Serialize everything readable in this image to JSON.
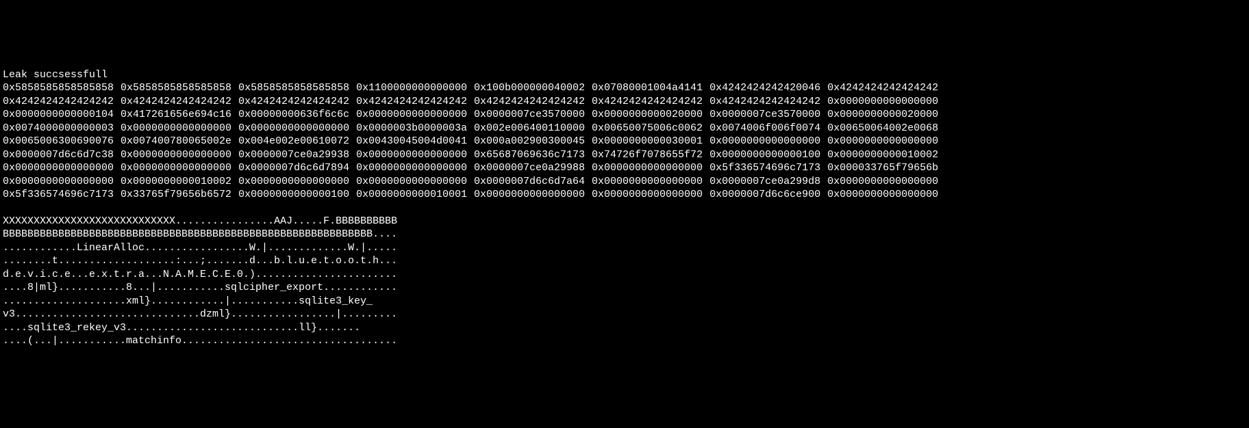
{
  "header": "Leak succsessfull",
  "hex_rows": [
    [
      "0x5858585858585858",
      "0x5858585858585858",
      "0x5858585858585858",
      "0x1100000000000000",
      "0x100b000000040002",
      "0x07080001004a4141",
      "0x4242424242420046",
      "0x4242424242424242"
    ],
    [
      "0x4242424242424242",
      "0x4242424242424242",
      "0x4242424242424242",
      "0x4242424242424242",
      "0x4242424242424242",
      "0x4242424242424242",
      "0x4242424242424242",
      "0x0000000000000000"
    ],
    [
      "0x0000000000000104",
      "0x417261656e694c16",
      "0x00000000636f6c6c",
      "0x0000000000000000",
      "0x0000007ce3570000",
      "0x0000000000020000",
      "0x0000007ce3570000",
      "0x0000000000020000"
    ],
    [
      "0x0074000000000003",
      "0x0000000000000000",
      "0x0000000000000000",
      "0x0000003b0000003a",
      "0x002e006400110000",
      "0x00650075006c0062",
      "0x0074006f006f0074",
      "0x00650064002e0068"
    ],
    [
      "0x0065006300690076",
      "0x007400780065002e",
      "0x004e002e00610072",
      "0x00430045004d0041",
      "0x000a002900300045",
      "0x0000000000030001",
      "0x0000000000000000",
      "0x0000000000000000"
    ],
    [
      "0x0000007d6c6d7c38",
      "0x0000000000000000",
      "0x0000007ce0a29938",
      "0x0000000000000000",
      "0x65687069636c7173",
      "0x74726f7078655f72",
      "0x0000000000000100",
      "0x0000000000010002"
    ],
    [
      "0x0000000000000000",
      "0x0000000000000000",
      "0x0000007d6c6d7894",
      "0x0000000000000000",
      "0x0000007ce0a29988",
      "0x0000000000000000",
      "0x5f336574696c7173",
      "0x000033765f79656b"
    ],
    [
      "0x0000000000000000",
      "0x0000000000010002",
      "0x0000000000000000",
      "0x0000000000000000",
      "0x0000007d6c6d7a64",
      "0x0000000000000000",
      "0x0000007ce0a299d8",
      "0x0000000000000000"
    ],
    [
      "0x5f336574696c7173",
      "0x33765f79656b6572",
      "0x0000000000000100",
      "0x0000000000010001",
      "0x0000000000000000",
      "0x0000000000000000",
      "0x0000007d6c6ce900",
      "0x0000000000000000"
    ]
  ],
  "ascii_dump": [
    "XXXXXXXXXXXXXXXXXXXXXXXXXXXX................AAJ.....F.BBBBBBBBBB",
    "BBBBBBBBBBBBBBBBBBBBBBBBBBBBBBBBBBBBBBBBBBBBBBBBBBBBBBBBBBBB....",
    "............LinearAlloc.................W.|.............W.|.....",
    "........t...................:...;.......d...b.l.u.e.t.o.o.t.h...",
    "d.e.v.i.c.e...e.x.t.r.a...N.A.M.E.C.E.0.).......................",
    "....8|ml}...........8...|...........sqlcipher_export............",
    "....................xml}............|...........sqlite3_key_",
    "v3..............................dzml}.................|.........",
    "....sqlite3_rekey_v3............................ll}.......",
    "....(...|...........matchinfo..................................."
  ]
}
